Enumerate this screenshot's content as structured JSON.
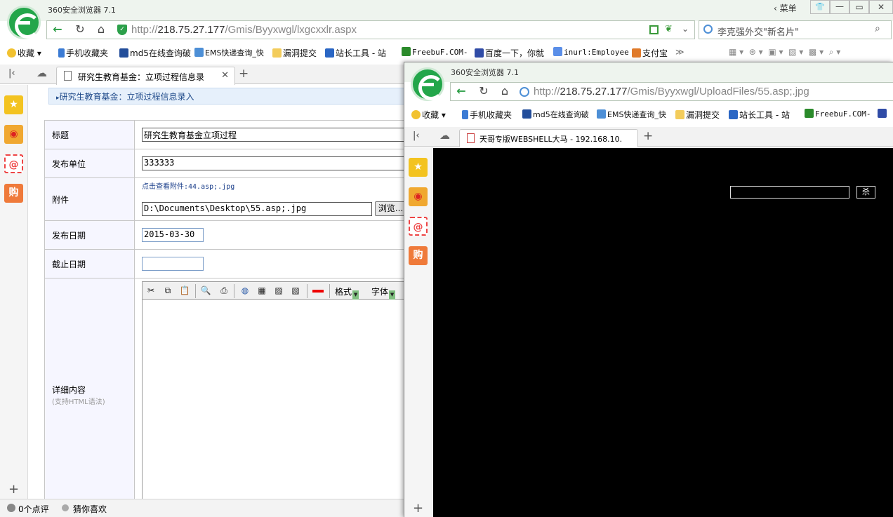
{
  "winA": {
    "app_title": "360安全浏览器 7.1",
    "menu_label": "菜单",
    "url_host": "218.75.27.177",
    "url_path": "/Gmis/Byyxwgl/lxgcxxlr.aspx",
    "url_scheme": "http://",
    "search_hint": "李克强外交\"新名片\"",
    "bookmarks": [
      "收藏",
      "手机收藏夹",
      "md5在线查询破",
      "EMS快递查询_快",
      "漏洞提交",
      "站长工具 - 站",
      "FreebuF.COM-",
      "百度一下，你就",
      "inurl:Employee",
      "支付宝"
    ],
    "more_glyph": "≫",
    "tab_title": "研究生教育基金：立项过程信息录",
    "breadcrumb": "研究生教育基金：立项过程信息录入",
    "form": {
      "title_label": "标题",
      "title_value": "研究生教育基金立项过程",
      "unit_label": "发布单位",
      "unit_value": "333333",
      "attach_label": "附件",
      "attach_link": "点击查看附件:44.asp;.jpg",
      "attach_path": "D:\\Documents\\Desktop\\55.asp;.jpg",
      "browse_label": "浏览...",
      "pubdate_label": "发布日期",
      "pubdate_value": "2015-03-30",
      "enddate_label": "截止日期",
      "enddate_value": "",
      "detail_label": "详细内容",
      "detail_hint": "(支持HTML语法)",
      "format_label": "格式",
      "font_label": "字体"
    },
    "status": {
      "comments": "0个点评",
      "guess": "猜你喜欢"
    }
  },
  "winB": {
    "app_title": "360安全浏览器 7.1",
    "url_scheme": "http://",
    "url_host": "218.75.27.177",
    "url_path": "/Gmis/Byyxwgl/UploadFiles/55.asp;.jpg",
    "bookmarks": [
      "收藏",
      "手机收藏夹",
      "md5在线查询破",
      "EMS快递查询_快",
      "漏洞提交",
      "站长工具 - 站",
      "FreebuF.COM-"
    ],
    "tab_title": "天哥专版WEBSHELL大马 - 192.168.10.",
    "shell_input": "",
    "shell_button": "杀"
  },
  "colors": {
    "accent_green": "#23a64a",
    "shell_bg": "#000000",
    "form_label_bg": "#f6f6ff",
    "breadcrumb_bg": "#e6f0fb"
  }
}
